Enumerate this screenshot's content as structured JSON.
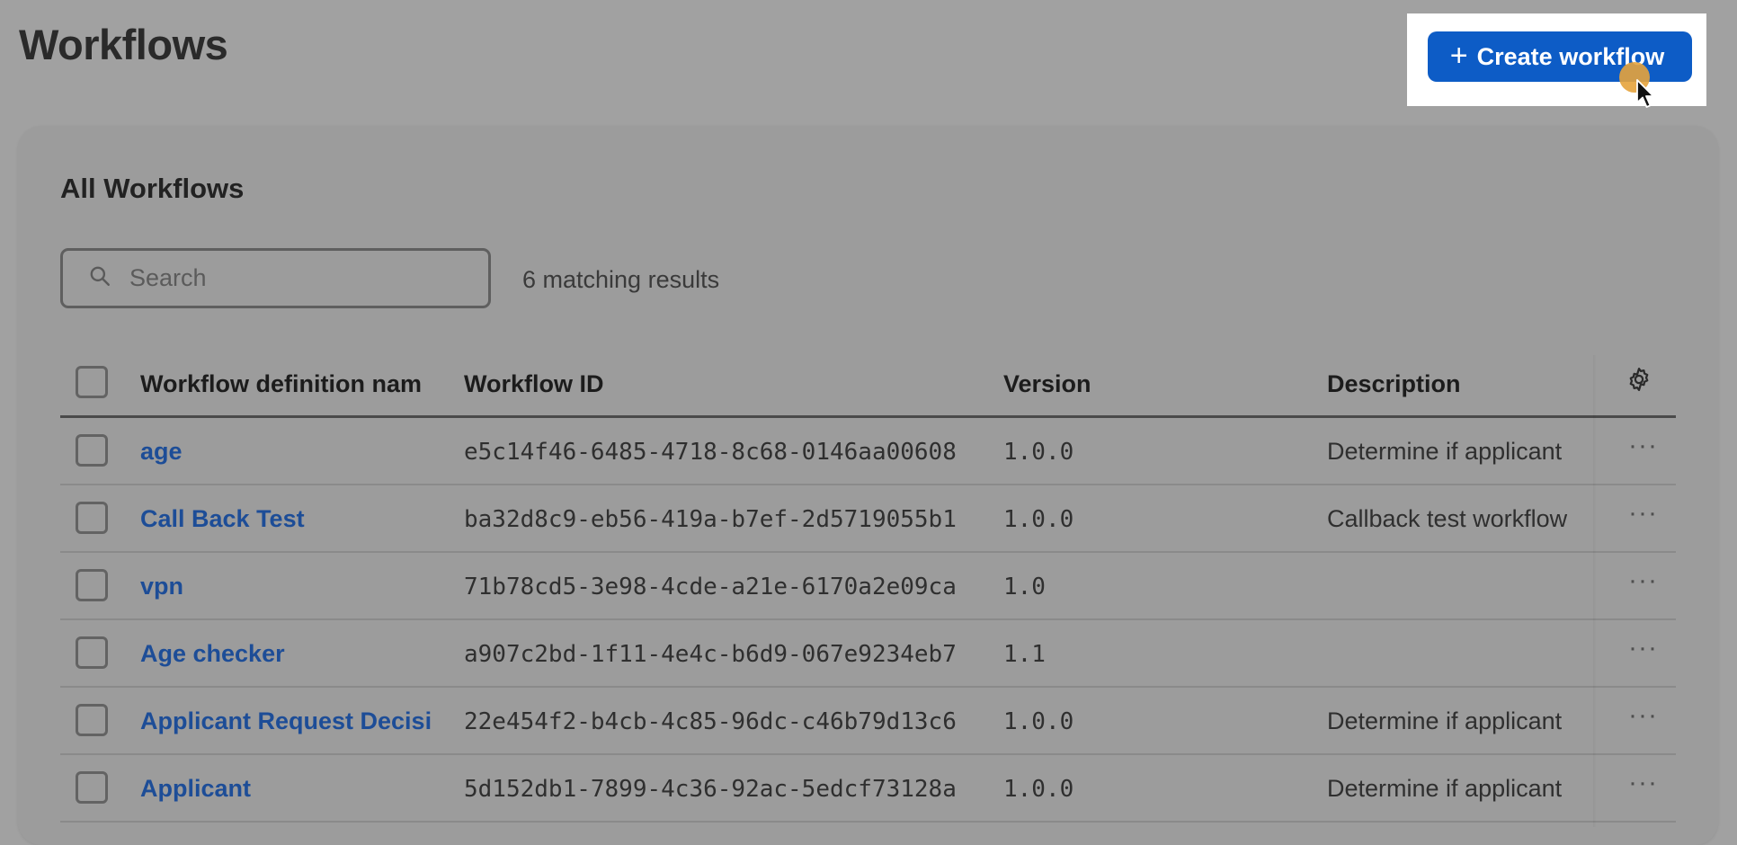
{
  "page": {
    "title": "Workflows",
    "create_button_label": "Create workflow"
  },
  "card": {
    "title": "All Workflows",
    "search": {
      "placeholder": "Search",
      "value": ""
    },
    "result_count": "6 matching results"
  },
  "table": {
    "columns": {
      "name": "Workflow definition nam",
      "id": "Workflow ID",
      "version": "Version",
      "description": "Description"
    },
    "rows": [
      {
        "name": "age",
        "id": "e5c14f46-6485-4718-8c68-0146aa00608",
        "version": "1.0.0",
        "description": "Determine if applicant"
      },
      {
        "name": "Call Back Test",
        "id": "ba32d8c9-eb56-419a-b7ef-2d5719055b1",
        "version": "1.0.0",
        "description": "Callback test workflow"
      },
      {
        "name": "vpn",
        "id": "71b78cd5-3e98-4cde-a21e-6170a2e09ca",
        "version": "1.0",
        "description": ""
      },
      {
        "name": "Age checker",
        "id": "a907c2bd-1f11-4e4c-b6d9-067e9234eb7",
        "version": "1.1",
        "description": ""
      },
      {
        "name": "Applicant Request Decisi",
        "id": "22e454f2-b4cb-4c85-96dc-c46b79d13c6",
        "version": "1.0.0",
        "description": "Determine if applicant"
      },
      {
        "name": "Applicant",
        "id": "5d152db1-7899-4c36-92ac-5edcf73128a",
        "version": "1.0.0",
        "description": "Determine if applicant"
      }
    ],
    "row_menu_glyph": "···"
  },
  "colors": {
    "primary": "#0d5cc6",
    "link": "#1d4d97",
    "overlay_bg": "#a1a1a1",
    "cursor_highlight": "#e5a33c"
  },
  "icons": [
    "plus-icon",
    "search-icon",
    "gear-icon",
    "more-icon",
    "cursor-arrow-icon"
  ]
}
